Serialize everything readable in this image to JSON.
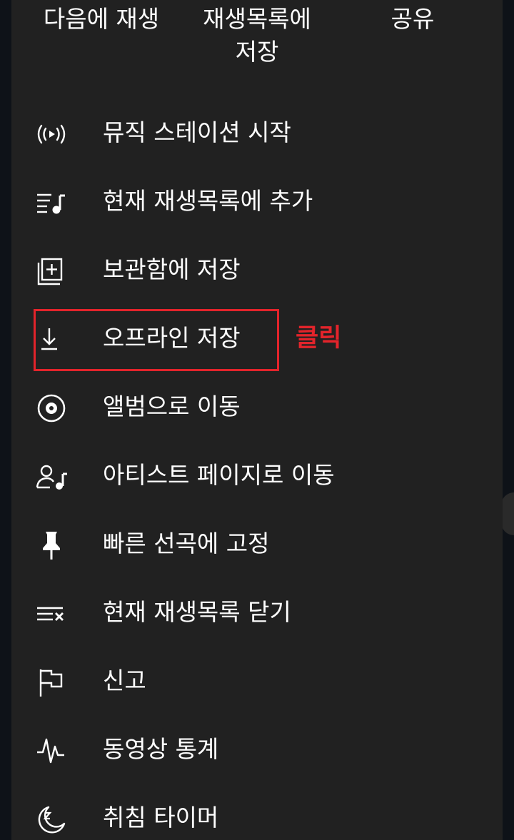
{
  "top_actions": {
    "play_next": "다음에 재생",
    "save_to_playlist_line1": "재생목록에",
    "save_to_playlist_line2": "저장",
    "share": "공유"
  },
  "menu": {
    "items": [
      {
        "label": "뮤직 스테이션 시작",
        "icon": "radio-icon"
      },
      {
        "label": "현재 재생목록에 추가",
        "icon": "queue-music-icon"
      },
      {
        "label": "보관함에 저장",
        "icon": "library-add-icon"
      },
      {
        "label": "오프라인 저장",
        "icon": "download-icon"
      },
      {
        "label": "앨범으로 이동",
        "icon": "album-icon"
      },
      {
        "label": "아티스트 페이지로 이동",
        "icon": "artist-icon"
      },
      {
        "label": "빠른 선곡에 고정",
        "icon": "pin-icon"
      },
      {
        "label": "현재 재생목록 닫기",
        "icon": "close-queue-icon"
      },
      {
        "label": "신고",
        "icon": "flag-icon"
      },
      {
        "label": "동영상 통계",
        "icon": "stats-icon"
      },
      {
        "label": "취침 타이머",
        "icon": "sleep-timer-icon"
      }
    ]
  },
  "annotation": {
    "text": "클릭",
    "color": "#e3242b"
  },
  "colors": {
    "sheet_background": "#212121",
    "text": "#ffffff",
    "highlight": "#e3242b"
  }
}
